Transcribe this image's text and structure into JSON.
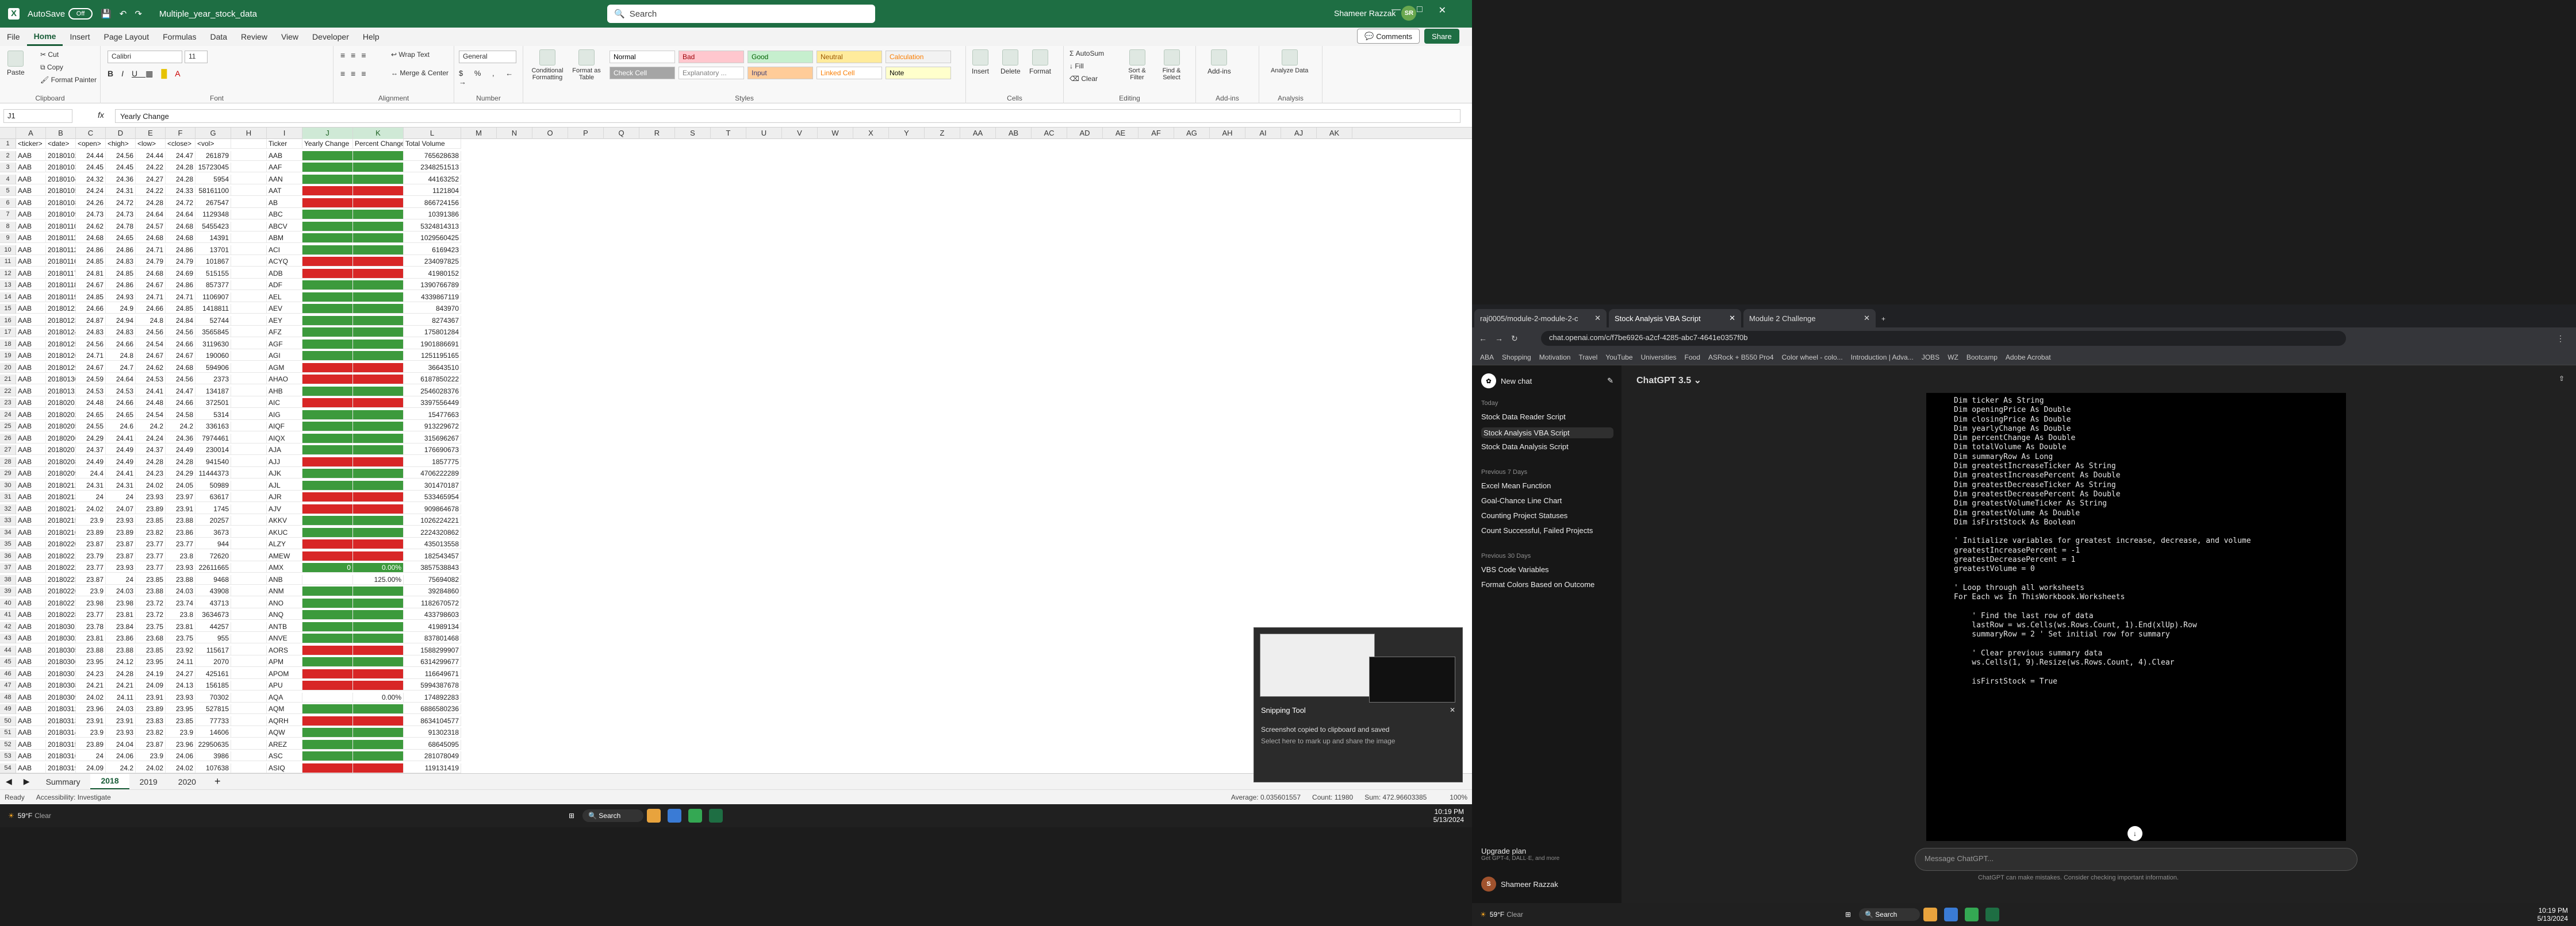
{
  "excel": {
    "autosave_label": "AutoSave",
    "autosave_state": "Off",
    "file_name": "Multiple_year_stock_data",
    "search_placeholder": "Search",
    "user_name": "Shameer Razzak",
    "user_initials": "SR",
    "menu_tabs": [
      "File",
      "Home",
      "Insert",
      "Page Layout",
      "Formulas",
      "Data",
      "Review",
      "View",
      "Developer",
      "Help"
    ],
    "active_menu": "Home",
    "comments_label": "Comments",
    "share_label": "Share",
    "ribbon": {
      "clipboard": {
        "label": "Clipboard",
        "paste": "Paste",
        "cut": "Cut",
        "copy": "Copy",
        "format_painter": "Format Painter"
      },
      "font": {
        "label": "Font",
        "font_name": "Calibri",
        "font_size": "11"
      },
      "alignment": {
        "label": "Alignment",
        "wrap_text": "Wrap Text",
        "merge_center": "Merge & Center"
      },
      "number": {
        "label": "Number",
        "format": "General"
      },
      "styles": {
        "label": "Styles",
        "conditional_formatting": "Conditional Formatting",
        "format_as_table": "Format as Table",
        "cells": [
          {
            "name": "Normal",
            "bg": "#ffffff",
            "fg": "#000000"
          },
          {
            "name": "Bad",
            "bg": "#ffc7ce",
            "fg": "#9c0006"
          },
          {
            "name": "Good",
            "bg": "#c6efce",
            "fg": "#006100"
          },
          {
            "name": "Neutral",
            "bg": "#ffeb9c",
            "fg": "#9c5700"
          },
          {
            "name": "Calculation",
            "bg": "#f2f2f2",
            "fg": "#fa7d00"
          },
          {
            "name": "Check Cell",
            "bg": "#a5a5a5",
            "fg": "#ffffff"
          },
          {
            "name": "Explanatory ...",
            "bg": "#ffffff",
            "fg": "#7f7f7f"
          },
          {
            "name": "Input",
            "bg": "#ffcc99",
            "fg": "#3f3f76"
          },
          {
            "name": "Linked Cell",
            "bg": "#ffffff",
            "fg": "#fa7d00"
          },
          {
            "name": "Note",
            "bg": "#ffffcc",
            "fg": "#000000"
          }
        ]
      },
      "cells": {
        "label": "Cells",
        "insert": "Insert",
        "delete": "Delete",
        "format": "Format"
      },
      "editing": {
        "label": "Editing",
        "autosum": "AutoSum",
        "fill": "Fill",
        "clear": "Clear",
        "sort_filter": "Sort & Filter",
        "find_select": "Find & Select"
      },
      "addins": {
        "label": "Add-ins",
        "addins": "Add-ins"
      },
      "analysis": {
        "label": "Analysis",
        "analyze_data": "Analyze Data"
      }
    },
    "name_box": "J1",
    "formula_bar": "Yearly Change",
    "columns": [
      "A",
      "B",
      "C",
      "D",
      "E",
      "F",
      "G",
      "H",
      "I",
      "J",
      "K",
      "L",
      "M",
      "N",
      "O",
      "P",
      "Q",
      "R",
      "S",
      "T",
      "U",
      "V",
      "W",
      "X",
      "Y",
      "Z",
      "AA",
      "AB",
      "AC",
      "AD",
      "AE",
      "AF",
      "AG",
      "AH",
      "AI",
      "AJ",
      "AK"
    ],
    "header_row": [
      "<ticker>",
      "<date>",
      "<open>",
      "<high>",
      "<low>",
      "<close>",
      "<vol>",
      "",
      "Ticker",
      "Yearly Change",
      "Percent Change",
      "Total Volume"
    ],
    "rows": [
      [
        "AAB",
        "20180102",
        "24.44",
        "24.56",
        "24.44",
        "24.47",
        "261879",
        "",
        "AAB",
        "",
        "",
        "765628638"
      ],
      [
        "AAB",
        "20180103",
        "24.45",
        "24.45",
        "24.22",
        "24.28",
        "15723045",
        "",
        "AAF",
        "",
        "",
        "2348251513"
      ],
      [
        "AAB",
        "20180104",
        "24.32",
        "24.36",
        "24.27",
        "24.28",
        "5954",
        "",
        "AAN",
        "",
        "",
        "44163252"
      ],
      [
        "AAB",
        "20180105",
        "24.24",
        "24.31",
        "24.22",
        "24.33",
        "58161100",
        "",
        "AAT",
        "",
        "",
        "1121804"
      ],
      [
        "AAB",
        "20180108",
        "24.26",
        "24.72",
        "24.28",
        "24.72",
        "267547",
        "",
        "AB",
        "",
        "",
        "866724156"
      ],
      [
        "AAB",
        "20180109",
        "24.73",
        "24.73",
        "24.64",
        "24.64",
        "1129348",
        "",
        "ABC",
        "",
        "",
        "10391386"
      ],
      [
        "AAB",
        "20180110",
        "24.62",
        "24.78",
        "24.57",
        "24.68",
        "5455423",
        "",
        "ABCV",
        "",
        "",
        "5324814313"
      ],
      [
        "AAB",
        "20180111",
        "24.68",
        "24.65",
        "24.68",
        "24.68",
        "14391",
        "",
        "ABM",
        "",
        "",
        "1029560425"
      ],
      [
        "AAB",
        "20180112",
        "24.86",
        "24.86",
        "24.71",
        "24.86",
        "13701",
        "",
        "ACI",
        "",
        "",
        "6169423"
      ],
      [
        "AAB",
        "20180116",
        "24.85",
        "24.83",
        "24.79",
        "24.79",
        "101867",
        "",
        "ACYQ",
        "",
        "",
        "234097825"
      ],
      [
        "AAB",
        "20180117",
        "24.81",
        "24.85",
        "24.68",
        "24.69",
        "515155",
        "",
        "ADB",
        "",
        "",
        "41980152"
      ],
      [
        "AAB",
        "20180118",
        "24.67",
        "24.86",
        "24.67",
        "24.86",
        "857377",
        "",
        "ADF",
        "",
        "",
        "1390766789"
      ],
      [
        "AAB",
        "20180119",
        "24.85",
        "24.93",
        "24.71",
        "24.71",
        "1106907",
        "",
        "AEL",
        "",
        "",
        "4339867119"
      ],
      [
        "AAB",
        "20180122",
        "24.66",
        "24.9",
        "24.66",
        "24.85",
        "1418811",
        "",
        "AEV",
        "",
        "",
        "843970"
      ],
      [
        "AAB",
        "20180123",
        "24.87",
        "24.94",
        "24.8",
        "24.84",
        "52744",
        "",
        "AEY",
        "",
        "",
        "8274367"
      ],
      [
        "AAB",
        "20180124",
        "24.83",
        "24.83",
        "24.56",
        "24.56",
        "3565845",
        "",
        "AFZ",
        "",
        "",
        "175801284"
      ],
      [
        "AAB",
        "20180125",
        "24.56",
        "24.66",
        "24.54",
        "24.66",
        "3119630",
        "",
        "AGF",
        "",
        "",
        "1901886691"
      ],
      [
        "AAB",
        "20180126",
        "24.71",
        "24.8",
        "24.67",
        "24.67",
        "190060",
        "",
        "AGI",
        "",
        "",
        "1251195165"
      ],
      [
        "AAB",
        "20180129",
        "24.67",
        "24.7",
        "24.62",
        "24.68",
        "594906",
        "",
        "AGM",
        "",
        "",
        "36643510"
      ],
      [
        "AAB",
        "20180130",
        "24.59",
        "24.64",
        "24.53",
        "24.56",
        "2373",
        "",
        "AHAO",
        "",
        "",
        "6187850222"
      ],
      [
        "AAB",
        "20180131",
        "24.53",
        "24.53",
        "24.41",
        "24.47",
        "134187",
        "",
        "AHB",
        "",
        "",
        "2546028376"
      ],
      [
        "AAB",
        "20180201",
        "24.48",
        "24.66",
        "24.48",
        "24.66",
        "372501",
        "",
        "AIC",
        "",
        "",
        "3397556449"
      ],
      [
        "AAB",
        "20180202",
        "24.65",
        "24.65",
        "24.54",
        "24.58",
        "5314",
        "",
        "AIG",
        "",
        "",
        "15477663"
      ],
      [
        "AAB",
        "20180205",
        "24.55",
        "24.6",
        "24.2",
        "24.2",
        "336163",
        "",
        "AIQF",
        "",
        "",
        "913229672"
      ],
      [
        "AAB",
        "20180206",
        "24.29",
        "24.41",
        "24.24",
        "24.36",
        "7974461",
        "",
        "AIQX",
        "",
        "",
        "315696267"
      ],
      [
        "AAB",
        "20180207",
        "24.37",
        "24.49",
        "24.37",
        "24.49",
        "230014",
        "",
        "AJA",
        "",
        "",
        "176690673"
      ],
      [
        "AAB",
        "20180208",
        "24.49",
        "24.49",
        "24.28",
        "24.28",
        "941540",
        "",
        "AJJ",
        "",
        "",
        "1857775"
      ],
      [
        "AAB",
        "20180209",
        "24.4",
        "24.41",
        "24.23",
        "24.29",
        "11444373",
        "",
        "AJK",
        "",
        "",
        "4706222289"
      ],
      [
        "AAB",
        "20180212",
        "24.31",
        "24.31",
        "24.02",
        "24.05",
        "50989",
        "",
        "AJL",
        "",
        "",
        "301470187"
      ],
      [
        "AAB",
        "20180213",
        "24",
        "24",
        "23.93",
        "23.97",
        "63617",
        "",
        "AJR",
        "",
        "",
        "533465954"
      ],
      [
        "AAB",
        "20180214",
        "24.02",
        "24.07",
        "23.89",
        "23.91",
        "1745",
        "",
        "AJV",
        "",
        "",
        "909864678"
      ],
      [
        "AAB",
        "20180215",
        "23.9",
        "23.93",
        "23.85",
        "23.88",
        "20257",
        "",
        "AKKV",
        "",
        "",
        "1026224221"
      ],
      [
        "AAB",
        "20180216",
        "23.89",
        "23.89",
        "23.82",
        "23.86",
        "3673",
        "",
        "AKUC",
        "",
        "",
        "2224320862"
      ],
      [
        "AAB",
        "20180220",
        "23.87",
        "23.87",
        "23.77",
        "23.77",
        "944",
        "",
        "ALZY",
        "",
        "",
        "435013558"
      ],
      [
        "AAB",
        "20180221",
        "23.79",
        "23.87",
        "23.77",
        "23.8",
        "72620",
        "",
        "AMEW",
        "",
        "",
        "182543457"
      ],
      [
        "AAB",
        "20180222",
        "23.77",
        "23.93",
        "23.77",
        "23.93",
        "22611665",
        "",
        "AMX",
        "",
        "",
        "3857538843"
      ],
      [
        "AAB",
        "20180223",
        "23.87",
        "24",
        "23.85",
        "23.88",
        "9468",
        "",
        "ANB",
        "",
        "",
        "75694082"
      ],
      [
        "AAB",
        "20180226",
        "23.9",
        "24.03",
        "23.88",
        "24.03",
        "43908",
        "",
        "ANM",
        "",
        "",
        "39284860"
      ],
      [
        "AAB",
        "20180227",
        "23.98",
        "23.98",
        "23.72",
        "23.74",
        "43713",
        "",
        "ANO",
        "",
        "",
        "1182670572"
      ],
      [
        "AAB",
        "20180228",
        "23.77",
        "23.81",
        "23.72",
        "23.8",
        "3634673",
        "",
        "ANQ",
        "",
        "",
        "433798603"
      ],
      [
        "AAB",
        "20180301",
        "23.78",
        "23.84",
        "23.75",
        "23.81",
        "44257",
        "",
        "ANTB",
        "",
        "",
        "41989134"
      ],
      [
        "AAB",
        "20180302",
        "23.81",
        "23.86",
        "23.68",
        "23.75",
        "955",
        "",
        "ANVE",
        "",
        "",
        "837801468"
      ],
      [
        "AAB",
        "20180305",
        "23.88",
        "23.88",
        "23.85",
        "23.92",
        "115617",
        "",
        "AORS",
        "",
        "",
        "1588299907"
      ],
      [
        "AAB",
        "20180306",
        "23.95",
        "24.12",
        "23.95",
        "24.11",
        "2070",
        "",
        "APM",
        "",
        "",
        "6314299677"
      ],
      [
        "AAB",
        "20180307",
        "24.23",
        "24.28",
        "24.19",
        "24.27",
        "425161",
        "",
        "APOM",
        "",
        "",
        "116649671"
      ],
      [
        "AAB",
        "20180308",
        "24.21",
        "24.21",
        "24.09",
        "24.13",
        "156185",
        "",
        "APU",
        "",
        "",
        "5994387678"
      ],
      [
        "AAB",
        "20180309",
        "24.02",
        "24.11",
        "23.91",
        "23.93",
        "70302",
        "",
        "AQA",
        "",
        "",
        "174892283"
      ],
      [
        "AAB",
        "20180312",
        "23.96",
        "24.03",
        "23.89",
        "23.95",
        "527815",
        "",
        "AQM",
        "",
        "",
        "6886580236"
      ],
      [
        "AAB",
        "20180313",
        "23.91",
        "23.91",
        "23.83",
        "23.85",
        "77733",
        "",
        "AQRH",
        "",
        "",
        "8634104577"
      ],
      [
        "AAB",
        "20180314",
        "23.9",
        "23.93",
        "23.82",
        "23.9",
        "14606",
        "",
        "AQW",
        "",
        "",
        "91302318"
      ],
      [
        "AAB",
        "20180315",
        "23.89",
        "24.04",
        "23.87",
        "23.96",
        "22950635",
        "",
        "AREZ",
        "",
        "",
        "68645095"
      ],
      [
        "AAB",
        "20180316",
        "24",
        "24.06",
        "23.9",
        "24.06",
        "3986",
        "",
        "ASC",
        "",
        "",
        "281078049"
      ],
      [
        "AAB",
        "20180319",
        "24.09",
        "24.2",
        "24.02",
        "24.02",
        "107638",
        "",
        "ASIQ",
        "",
        "",
        "119131419"
      ]
    ],
    "change_colors": [
      "pos",
      "pos",
      "pos",
      "neg",
      "neg",
      "pos",
      "pos",
      "pos",
      "pos",
      "neg",
      "neg",
      "pos",
      "pos",
      "pos",
      "pos",
      "pos",
      "pos",
      "pos",
      "neg",
      "neg",
      "pos",
      "neg",
      "pos",
      "pos",
      "pos",
      "pos",
      "neg",
      "pos",
      "pos",
      "neg",
      "neg",
      "pos",
      "pos",
      "neg",
      "neg",
      "pos",
      "zero",
      "pos",
      "pos",
      "pos",
      "pos",
      "pos",
      "neg",
      "pos",
      "neg",
      "neg",
      "zero",
      "pos",
      "neg",
      "pos",
      "pos",
      "pos",
      "neg"
    ],
    "visible_values": {
      "J37": "0",
      "K37": "0.00%",
      "K38": "125.00%",
      "K48": "0.00%"
    },
    "sheet_tabs": [
      "Summary",
      "2018",
      "2019",
      "2020"
    ],
    "active_sheet": "2018",
    "status_left": "Ready",
    "status_accessibility": "Accessibility: Investigate",
    "status_average": "Average: 0.035601557",
    "status_count": "Count: 11980",
    "status_sum": "Sum: 472.96603385",
    "status_zoom": "100%",
    "snip": {
      "title": "Snipping Tool",
      "message": "Screenshot copied to clipboard and saved",
      "sub": "Select here to mark up and share the image"
    }
  },
  "taskbar1": {
    "weather_temp": "59°F",
    "weather_desc": "Clear",
    "search": "Search",
    "time": "10:19 PM",
    "date": "5/13/2024"
  },
  "chrome": {
    "tabs": [
      "raj0005/module-2-module-2-c",
      "Stock Analysis VBA Script",
      "Module 2 Challenge"
    ],
    "active_tab": 1,
    "url": "chat.openai.com/c/f7be6926-a2cf-4285-abc7-4641e0357f0b",
    "bookmarks": [
      "ABA",
      "Shopping",
      "Motivation",
      "Travel",
      "YouTube",
      "Universities",
      "Food",
      "ASRock + B550 Pro4",
      "Color wheel - colo...",
      "Introduction | Adva...",
      "JOBS",
      "WZ",
      "Bootcamp",
      "Adobe Acrobat"
    ]
  },
  "gpt": {
    "new_chat": "New chat",
    "model": "ChatGPT 3.5",
    "sections": [
      {
        "title": "Today",
        "items": [
          "Stock Data Reader Script",
          "Stock Analysis VBA Script",
          "Stock Data Analysis Script"
        ]
      },
      {
        "title": "Previous 7 Days",
        "items": [
          "Excel Mean Function",
          "Goal-Chance Line Chart",
          "Counting Project Statuses",
          "Count Successful, Failed Projects"
        ]
      },
      {
        "title": "Previous 30 Days",
        "items": [
          "VBS Code Variables",
          "Format Colors Based on Outcome"
        ]
      }
    ],
    "active_item": "Stock Analysis VBA Script",
    "upgrade_title": "Upgrade plan",
    "upgrade_sub": "Get GPT-4, DALL·E, and more",
    "user_name": "Shameer Razzak",
    "code_lines": [
      "Dim ticker As String",
      "Dim openingPrice As Double",
      "Dim closingPrice As Double",
      "Dim yearlyChange As Double",
      "Dim percentChange As Double",
      "Dim totalVolume As Double",
      "Dim summaryRow As Long",
      "Dim greatestIncreaseTicker As String",
      "Dim greatestIncreasePercent As Double",
      "Dim greatestDecreaseTicker As String",
      "Dim greatestDecreasePercent As Double",
      "Dim greatestVolumeTicker As String",
      "Dim greatestVolume As Double",
      "Dim isFirstStock As Boolean",
      "",
      "' Initialize variables for greatest increase, decrease, and volume",
      "greatestIncreasePercent = -1",
      "greatestDecreasePercent = 1",
      "greatestVolume = 0",
      "",
      "' Loop through all worksheets",
      "For Each ws In ThisWorkbook.Worksheets",
      "",
      "    ' Find the last row of data",
      "    lastRow = ws.Cells(ws.Rows.Count, 1).End(xlUp).Row",
      "    summaryRow = 2 ' Set initial row for summary",
      "",
      "    ' Clear previous summary data",
      "    ws.Cells(1, 9).Resize(ws.Rows.Count, 4).Clear",
      "",
      "    isFirstStock = True"
    ],
    "input_placeholder": "Message ChatGPT...",
    "disclaimer": "ChatGPT can make mistakes. Consider checking important information."
  },
  "taskbar2": {
    "weather_temp": "59°F",
    "weather_desc": "Clear",
    "search": "Search",
    "time": "10:19 PM",
    "date": "5/13/2024"
  },
  "colors": {
    "excel_green": "#1e6e43",
    "positive": "#3c9a3c",
    "negative": "#d82626"
  }
}
